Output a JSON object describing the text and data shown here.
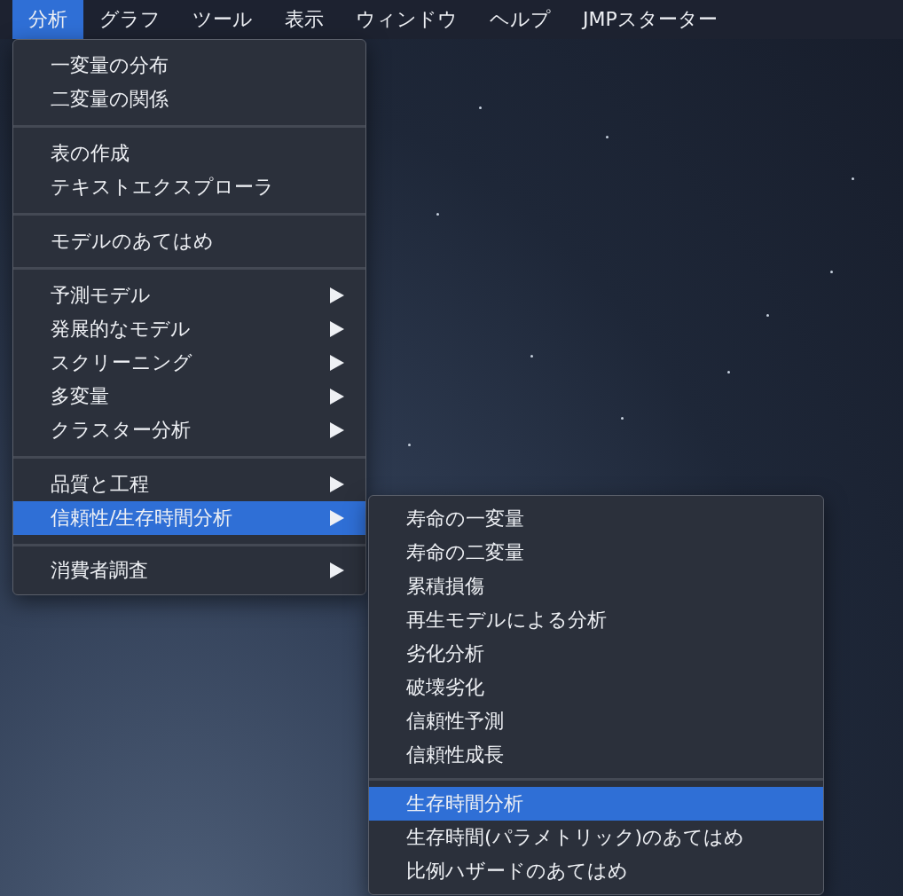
{
  "menu_bar": [
    {
      "label": "分析",
      "selected": true
    },
    {
      "label": "グラフ",
      "selected": false
    },
    {
      "label": "ツール",
      "selected": false
    },
    {
      "label": "表示",
      "selected": false
    },
    {
      "label": "ウィンドウ",
      "selected": false
    },
    {
      "label": "ヘルプ",
      "selected": false
    },
    {
      "label": "JMPスターター",
      "selected": false
    }
  ],
  "menu": {
    "groups": [
      [
        {
          "label": "一変量の分布",
          "submenu": false,
          "selected": false
        },
        {
          "label": "二変量の関係",
          "submenu": false,
          "selected": false
        }
      ],
      [
        {
          "label": "表の作成",
          "submenu": false,
          "selected": false
        },
        {
          "label": "テキストエクスプローラ",
          "submenu": false,
          "selected": false
        }
      ],
      [
        {
          "label": "モデルのあてはめ",
          "submenu": false,
          "selected": false
        }
      ],
      [
        {
          "label": "予測モデル",
          "submenu": true,
          "selected": false
        },
        {
          "label": "発展的なモデル",
          "submenu": true,
          "selected": false
        },
        {
          "label": "スクリーニング",
          "submenu": true,
          "selected": false
        },
        {
          "label": "多変量",
          "submenu": true,
          "selected": false
        },
        {
          "label": "クラスター分析",
          "submenu": true,
          "selected": false
        }
      ],
      [
        {
          "label": "品質と工程",
          "submenu": true,
          "selected": false
        },
        {
          "label": "信頼性/生存時間分析",
          "submenu": true,
          "selected": true
        }
      ],
      [
        {
          "label": "消費者調査",
          "submenu": true,
          "selected": false
        }
      ]
    ]
  },
  "submenu": {
    "groups": [
      [
        {
          "label": "寿命の一変量",
          "selected": false
        },
        {
          "label": "寿命の二変量",
          "selected": false
        },
        {
          "label": "累積損傷",
          "selected": false
        },
        {
          "label": "再生モデルによる分析",
          "selected": false
        },
        {
          "label": "劣化分析",
          "selected": false
        },
        {
          "label": "破壊劣化",
          "selected": false
        },
        {
          "label": "信頼性予測",
          "selected": false
        },
        {
          "label": "信頼性成長",
          "selected": false
        }
      ],
      [
        {
          "label": "生存時間分析",
          "selected": true
        },
        {
          "label": "生存時間(パラメトリック)のあてはめ",
          "selected": false
        },
        {
          "label": "比例ハザードのあてはめ",
          "selected": false
        }
      ]
    ]
  }
}
